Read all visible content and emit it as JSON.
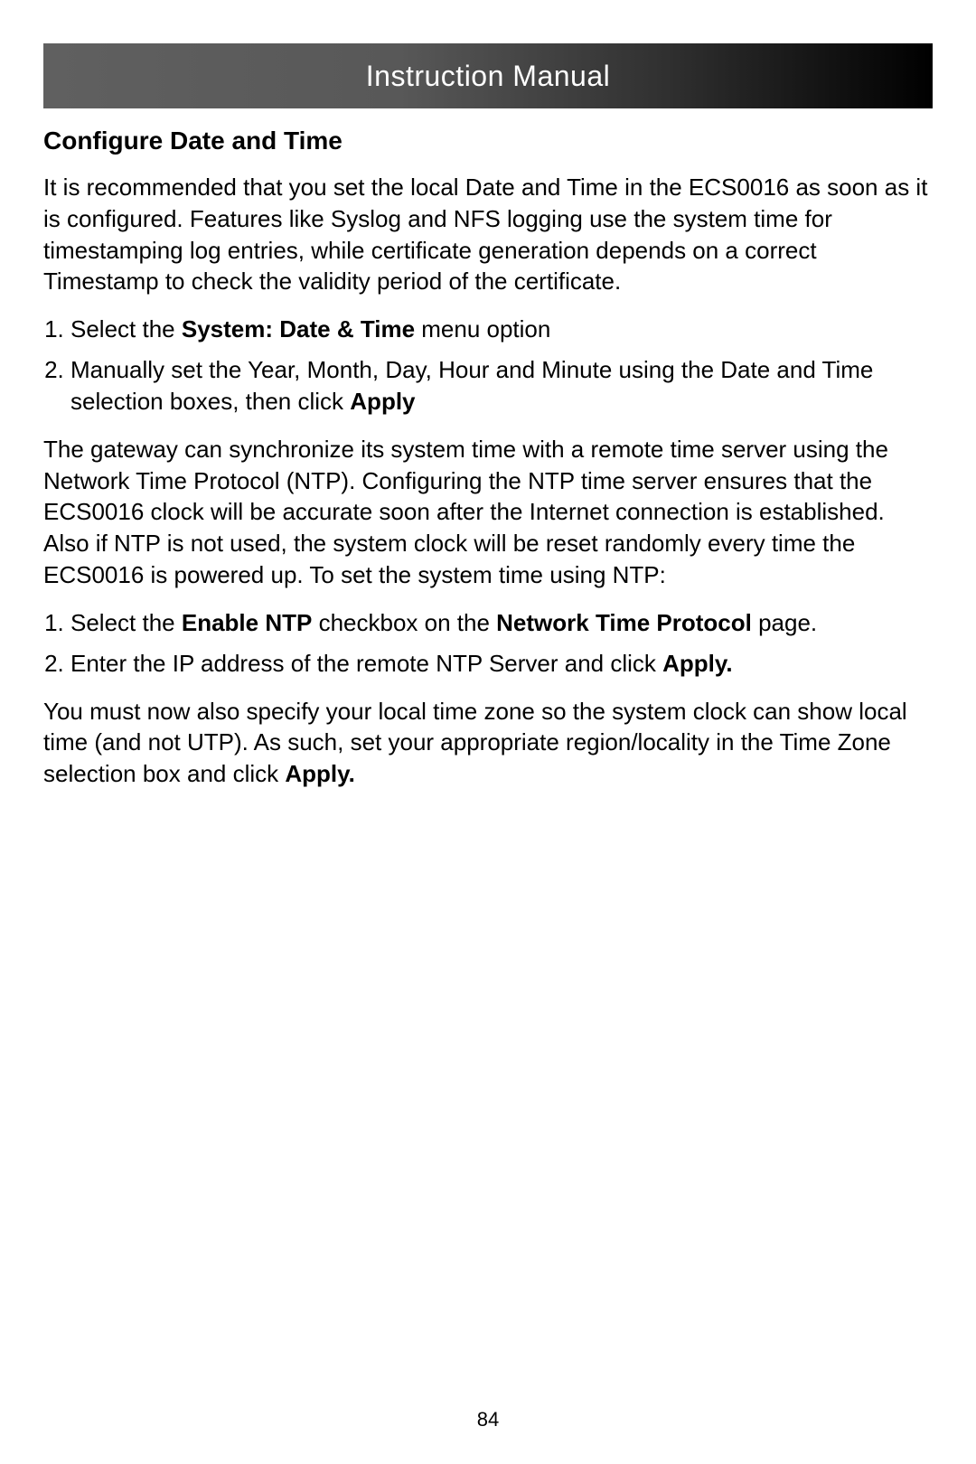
{
  "banner": {
    "title": "Instruction Manual"
  },
  "section": {
    "heading": "Configure Date and Time",
    "para1": "It is recommended that you set the local Date and Time in the ECS0016 as soon as it is configured. Features like Syslog and NFS logging use the system time for timestamping log entries, while certificate generation depends on a correct Timestamp to check the validity period of the certificate.",
    "list1": {
      "item1_pre": "Select the ",
      "item1_bold": "System: Date & Time",
      "item1_post": " menu option",
      "item2_pre": "Manually set the Year, Month, Day, Hour and Minute using the Date and Time selection boxes, then click ",
      "item2_bold": "Apply"
    },
    "para2": "The gateway can synchronize its system time with a remote time server using the Network Time Protocol (NTP). Configuring the NTP time server ensures that the ECS0016 clock will be accurate soon after the Internet connection is established. Also if NTP is not used, the system clock will be reset randomly every time the ECS0016 is powered up. To set the system time using NTP:",
    "list2": {
      "item1_pre": "Select the ",
      "item1_bold1": "Enable NTP",
      "item1_mid": " checkbox on the ",
      "item1_bold2": "Network Time Protocol",
      "item1_post": " page.",
      "item2_pre": "Enter the IP address of the remote NTP Server and click ",
      "item2_bold": "Apply."
    },
    "para3_pre": "You must now also specify your local time zone so the system clock can show local time (and not UTP).  As such, set your appropriate region/locality in the Time Zone selection box and click ",
    "para3_bold": "Apply."
  },
  "page_number": "84"
}
